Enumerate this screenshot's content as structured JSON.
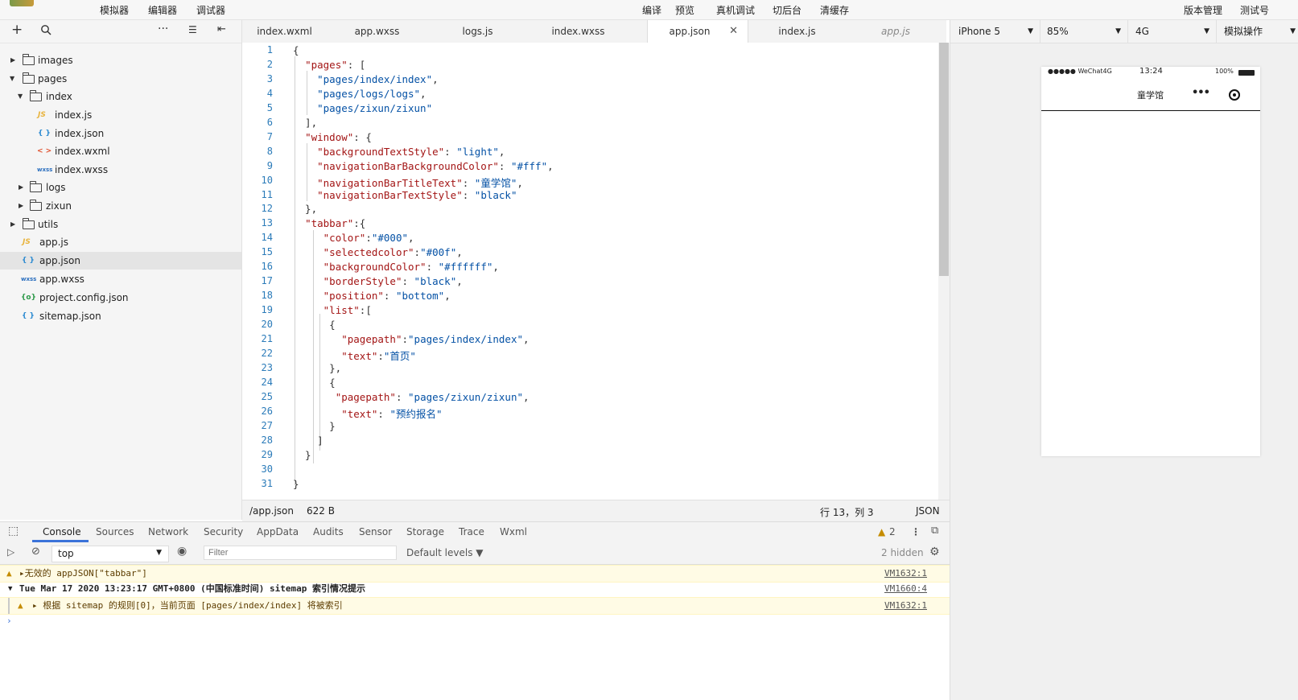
{
  "topbar": {
    "left_menu": [
      "模拟器",
      "编辑器",
      "调试器"
    ],
    "center_menu": [
      "编译",
      "预览",
      "真机调试",
      "切后台",
      "清缓存"
    ],
    "right_menu": [
      "版本管理",
      "测试号"
    ]
  },
  "explorer": {
    "tree": [
      {
        "label": "images",
        "kind": "folder",
        "expanded": false
      },
      {
        "label": "pages",
        "kind": "folder",
        "expanded": true
      },
      {
        "label": "index",
        "kind": "folder",
        "expanded": true
      },
      {
        "label": "index.js",
        "kind": "js"
      },
      {
        "label": "index.json",
        "kind": "json"
      },
      {
        "label": "index.wxml",
        "kind": "wxml"
      },
      {
        "label": "index.wxss",
        "kind": "wxss"
      },
      {
        "label": "logs",
        "kind": "folder",
        "expanded": false
      },
      {
        "label": "zixun",
        "kind": "folder",
        "expanded": false
      },
      {
        "label": "utils",
        "kind": "folder",
        "expanded": false
      },
      {
        "label": "app.js",
        "kind": "js"
      },
      {
        "label": "app.json",
        "kind": "json",
        "selected": true
      },
      {
        "label": "app.wxss",
        "kind": "wxss"
      },
      {
        "label": "project.config.json",
        "kind": "config"
      },
      {
        "label": "sitemap.json",
        "kind": "json"
      }
    ]
  },
  "editor": {
    "tabs": [
      "index.wxml",
      "app.wxss",
      "logs.js",
      "index.wxss",
      "app.json",
      "index.js",
      "app.js"
    ],
    "active_tab": "app.json",
    "code_lines": [
      "{",
      "  \"pages\": [",
      "    \"pages/index/index\",",
      "    \"pages/logs/logs\",",
      "    \"pages/zixun/zixun\"",
      "  ],",
      "  \"window\": {",
      "    \"backgroundTextStyle\": \"light\",",
      "    \"navigationBarBackgroundColor\": \"#fff\",",
      "    \"navigationBarTitleText\": \"童学馆\",",
      "    \"navigationBarTextStyle\": \"black\"",
      "  },",
      "  \"tabbar\":{",
      "     \"color\":\"#000\",",
      "     \"selectedcolor\":\"#00f\",",
      "     \"backgroundColor\": \"#ffffff\",",
      "     \"borderStyle\": \"black\",",
      "     \"position\": \"bottom\",",
      "     \"list\":[",
      "      {",
      "        \"pagepath\":\"pages/index/index\",",
      "        \"text\":\"首页\"",
      "      },",
      "      {",
      "       \"pagepath\": \"pages/zixun/zixun\",",
      "        \"text\": \"预约报名\"",
      "      }",
      "    ]",
      "  }",
      "",
      "}"
    ],
    "status": {
      "path": "/app.json",
      "size": "622 B",
      "cursor": "行 13，列 3",
      "language": "JSON"
    }
  },
  "simulator": {
    "device": "iPhone 5",
    "zoom": "85%",
    "network": "4G",
    "ops": "模拟操作",
    "phone": {
      "carrier": "●●●●● WeChat4G",
      "time": "13:24",
      "battery": "100%",
      "nav_title": "童学馆"
    }
  },
  "devtools": {
    "tabs": [
      "Console",
      "Sources",
      "Network",
      "Security",
      "AppData",
      "Audits",
      "Sensor",
      "Storage",
      "Trace",
      "Wxml"
    ],
    "active_tab": "Console",
    "warning_count": "2",
    "context": "top",
    "filter_placeholder": "Filter",
    "levels": "Default levels ▼",
    "hidden": "2 hidden",
    "messages": [
      {
        "type": "warn",
        "text": "▸无效的 appJSON[\"tabbar\"]",
        "source": "VM1632:1"
      },
      {
        "type": "group",
        "text": "Tue Mar 17 2020 13:23:17 GMT+0800 (中国标准时间) sitemap 索引情况提示",
        "source": "VM1660:4"
      },
      {
        "type": "warn",
        "text": "▸ 根据 sitemap 的规则[0]，当前页面 [pages/index/index] 将被索引",
        "source": "VM1632:1"
      }
    ],
    "prompt": "›"
  }
}
